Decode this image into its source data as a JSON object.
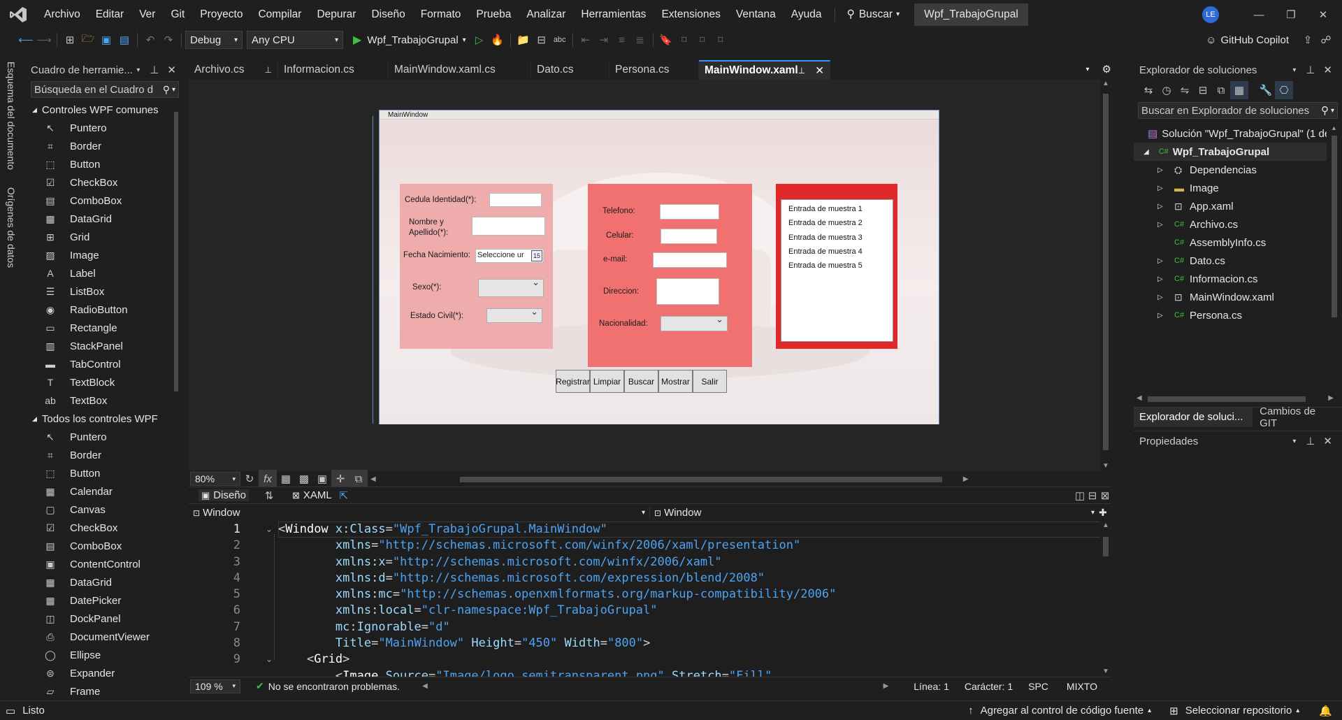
{
  "menu": [
    "Archivo",
    "Editar",
    "Ver",
    "Git",
    "Proyecto",
    "Compilar",
    "Depurar",
    "Diseño",
    "Formato",
    "Prueba",
    "Analizar",
    "Herramientas",
    "Extensiones",
    "Ventana",
    "Ayuda"
  ],
  "search_label": "Buscar",
  "solution_title": "Wpf_TrabajoGrupal",
  "user_initials": "LE",
  "toolbar": {
    "config": "Debug",
    "platform": "Any CPU",
    "run_target": "Wpf_TrabajoGrupal",
    "copilot": "GitHub Copilot"
  },
  "side_tabs": [
    "Esquema del documento",
    "Orígenes de datos"
  ],
  "toolbox": {
    "title": "Cuadro de herramie...",
    "search_placeholder": "Búsqueda en el Cuadro d",
    "group1": "Controles WPF comunes",
    "common": [
      "Puntero",
      "Border",
      "Button",
      "CheckBox",
      "ComboBox",
      "DataGrid",
      "Grid",
      "Image",
      "Label",
      "ListBox",
      "RadioButton",
      "Rectangle",
      "StackPanel",
      "TabControl",
      "TextBlock",
      "TextBox"
    ],
    "group2": "Todos los controles WPF",
    "all": [
      "Puntero",
      "Border",
      "Button",
      "Calendar",
      "Canvas",
      "CheckBox",
      "ComboBox",
      "ContentControl",
      "DataGrid",
      "DatePicker",
      "DockPanel",
      "DocumentViewer",
      "Ellipse",
      "Expander",
      "Frame"
    ]
  },
  "tabs": [
    "Archivo.cs",
    "Informacion.cs",
    "MainWindow.xaml.cs",
    "Dato.cs",
    "Persona.cs",
    "MainWindow.xaml"
  ],
  "designer": {
    "window_title": "MainWindow",
    "zoom": "80%",
    "form1": {
      "cedula": "Cedula Identidad(*):",
      "nombre": "Nombre y\nApellido(*):",
      "fecha": "Fecha Nacimiento:",
      "fecha_placeholder": "Seleccione ur",
      "calendar_day": "15",
      "sexo": "Sexo(*):",
      "estado": "Estado Civil(*):"
    },
    "form2": {
      "telefono": "Telefono:",
      "celular": "Celular:",
      "email": "e-mail:",
      "direccion": "Direccion:",
      "nacionalidad": "Nacionalidad:"
    },
    "list": [
      "Entrada de muestra 1",
      "Entrada de muestra 2",
      "Entrada de muestra 3",
      "Entrada de muestra 4",
      "Entrada de muestra 5"
    ],
    "buttons": [
      "Registrar",
      "Limpiar",
      "Buscar",
      "Mostrar",
      "Salir"
    ]
  },
  "split": {
    "design_tab": "Diseño",
    "xaml_tab": "XAML",
    "left_scope": "Window",
    "right_scope": "Window"
  },
  "code": {
    "line_numbers": [
      "1",
      "2",
      "3",
      "4",
      "5",
      "6",
      "7",
      "8",
      "9"
    ],
    "zoom": "109 %",
    "issues": "No se encontraron problemas.",
    "line": "Línea: 1",
    "char": "Carácter: 1",
    "spc": "SPC",
    "eol": "MIXTO"
  },
  "solution_explorer": {
    "title": "Explorador de soluciones",
    "search_placeholder": "Buscar en Explorador de soluciones",
    "solution": "Solución \"Wpf_TrabajoGrupal\" (1 de",
    "project": "Wpf_TrabajoGrupal",
    "items": [
      "Dependencias",
      "Image",
      "App.xaml",
      "Archivo.cs",
      "AssemblyInfo.cs",
      "Dato.cs",
      "Informacion.cs",
      "MainWindow.xaml",
      "Persona.cs"
    ],
    "bottom_tab1": "Explorador de soluci...",
    "bottom_tab2": "Cambios de GIT"
  },
  "properties": {
    "title": "Propiedades"
  },
  "status": {
    "ready": "Listo",
    "source_control": "Agregar al control de código fuente",
    "repo": "Seleccionar repositorio"
  }
}
